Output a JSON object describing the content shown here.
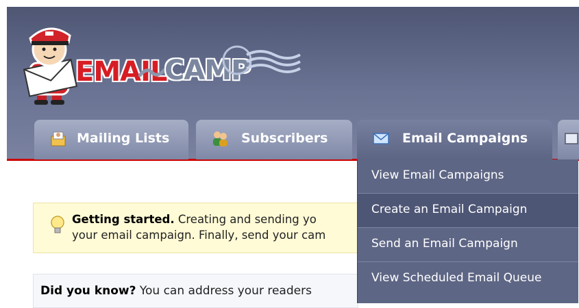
{
  "brand": {
    "logo_word_1": "EMAIL",
    "logo_word_2": "CAMP",
    "colors": {
      "header": "#5a6281",
      "accent_red": "#cc0000",
      "tab": "#8e97b3"
    }
  },
  "tabs": [
    {
      "label": "Mailing Lists",
      "icon": "mailing-list-icon"
    },
    {
      "label": "Subscribers",
      "icon": "subscribers-icon"
    },
    {
      "label": "Email Campaigns",
      "icon": "envelope-icon"
    }
  ],
  "dropdown": {
    "items": [
      {
        "label": "View Email Campaigns"
      },
      {
        "label": "Create an Email Campaign"
      },
      {
        "label": "Send an Email Campaign"
      },
      {
        "label": "View Scheduled Email Queue"
      }
    ]
  },
  "getting_started": {
    "icon": "lightbulb-icon",
    "title": "Getting started.",
    "line1_text": " Creating and sending yo",
    "line2_text": "your email campaign. Finally, send your cam"
  },
  "did_you_know": {
    "title": "Did you know?",
    "text": " You can address your readers"
  }
}
